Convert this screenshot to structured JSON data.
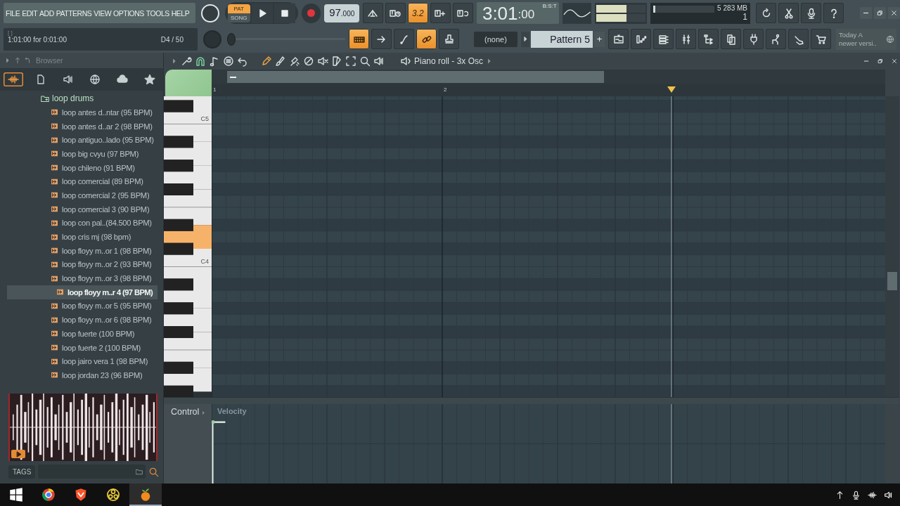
{
  "menu": [
    "FILE",
    "EDIT",
    "ADD",
    "PATTERNS",
    "VIEW",
    "OPTIONS",
    "TOOLS",
    "HELP"
  ],
  "hint": {
    "bracket": "[   ]",
    "text": "1:01:00 for 0:01:00",
    "position": "D4 / 50"
  },
  "transport": {
    "pat_label": "PAT",
    "song_label": "SONG",
    "pattern_mode": true
  },
  "tempo": {
    "whole": "97",
    "fraction": ".000"
  },
  "pitch": {
    "level": 0
  },
  "tools_top": [
    {
      "kind": "metronome",
      "on": false
    },
    {
      "kind": "keys-clock",
      "on": false
    },
    {
      "kind": "countdown",
      "label": "3.2",
      "on": true
    },
    {
      "kind": "keys-plus",
      "on": false
    },
    {
      "kind": "keys-loop",
      "on": false
    }
  ],
  "tools_bottom": [
    {
      "kind": "keyboard",
      "on": true
    },
    {
      "kind": "arrow",
      "on": false
    },
    {
      "kind": "curve",
      "on": false
    },
    {
      "kind": "link",
      "on": true
    },
    {
      "kind": "stamp",
      "on": false
    }
  ],
  "time": {
    "main": "3:01",
    "sub": ":00",
    "unit": "B:S:T"
  },
  "meter": {
    "left": {
      "level": 0.62
    },
    "right": {
      "level": 0.62
    }
  },
  "cpu": {
    "level": 0.04,
    "polyphony": "5",
    "memory": "283 MB",
    "voices": "1"
  },
  "actions": [
    {
      "kind": "refresh"
    },
    {
      "kind": "scissors"
    },
    {
      "kind": "microphone"
    },
    {
      "kind": "question"
    }
  ],
  "window_controls": [
    {
      "kind": "minimize"
    },
    {
      "kind": "restore"
    },
    {
      "kind": "close"
    }
  ],
  "pattern": {
    "channel": "(none)",
    "name": "Pattern 5",
    "add": "+"
  },
  "windows": [
    {
      "kind": "playlist",
      "on": false
    },
    {
      "kind": "bars-steps",
      "on": false
    },
    {
      "kind": "list",
      "on": false
    },
    {
      "kind": "sliders",
      "on": false
    },
    {
      "kind": "tree",
      "on": false
    },
    {
      "kind": "pages",
      "on": false
    },
    {
      "kind": "plug",
      "on": false
    },
    {
      "kind": "figure",
      "on": false
    },
    {
      "kind": "hand",
      "on": false
    },
    {
      "kind": "cart",
      "on": false
    }
  ],
  "news": {
    "line1": "Today  A",
    "line2": "newer versi.."
  },
  "browser": {
    "title": "Browser",
    "tabs": [
      {
        "kind": "waveform",
        "selected": true
      },
      {
        "kind": "file",
        "selected": false
      },
      {
        "kind": "speaker",
        "selected": false
      },
      {
        "kind": "globe",
        "selected": false
      },
      {
        "kind": "cloud",
        "selected": false
      },
      {
        "kind": "star",
        "selected": false
      }
    ],
    "folder": "loop drums",
    "items": [
      {
        "label": "loop antes d..ntar (95 BPM)",
        "selected": false
      },
      {
        "label": "loop antes d..ar 2 (98 BPM)",
        "selected": false
      },
      {
        "label": "loop antiguo..lado (95 BPM)",
        "selected": false
      },
      {
        "label": "loop big cvyu (97 BPM)",
        "selected": false
      },
      {
        "label": "loop chileno (91 BPM)",
        "selected": false
      },
      {
        "label": "loop comercial (89 BPM)",
        "selected": false
      },
      {
        "label": "loop comercial 2 (95 BPM)",
        "selected": false
      },
      {
        "label": "loop comercial 3 (90 BPM)",
        "selected": false
      },
      {
        "label": "loop con pal..(84.500 BPM)",
        "selected": false
      },
      {
        "label": "loop cris mj (98 bpm)",
        "selected": false
      },
      {
        "label": "loop floyy m..or 1 (98 BPM)",
        "selected": false
      },
      {
        "label": "loop floyy m..or 2 (93 BPM)",
        "selected": false
      },
      {
        "label": "loop floyy m..or 3 (98 BPM)",
        "selected": false
      },
      {
        "label": "loop floyy m..r 4 (97 BPM)",
        "selected": true
      },
      {
        "label": "loop floyy m..or 5 (95 BPM)",
        "selected": false
      },
      {
        "label": "loop floyy m..or 6 (98 BPM)",
        "selected": false
      },
      {
        "label": "loop fuerte (100 BPM)",
        "selected": false
      },
      {
        "label": "loop fuerte 2 (100 BPM)",
        "selected": false
      },
      {
        "label": "loop jairo vera 1 (98 BPM)",
        "selected": false
      },
      {
        "label": "loop jordan 23 (96 BPM)",
        "selected": false
      }
    ],
    "tags_label": "TAGS"
  },
  "piano_roll": {
    "title": "Piano roll - 3x Osc",
    "tools": [
      {
        "kind": "wrench",
        "on": false
      },
      {
        "kind": "magnet",
        "on": true
      },
      {
        "kind": "note",
        "on": false
      },
      {
        "kind": "menu",
        "on": false
      },
      {
        "kind": "undo",
        "on": false
      },
      {
        "kind": "pencil",
        "on": true
      },
      {
        "kind": "brush",
        "on": false
      },
      {
        "kind": "spray",
        "on": false
      },
      {
        "kind": "forbid",
        "on": false
      },
      {
        "kind": "mute",
        "on": false
      },
      {
        "kind": "slice",
        "on": false
      },
      {
        "kind": "frame",
        "on": false
      },
      {
        "kind": "zoom",
        "on": false
      },
      {
        "kind": "speaker",
        "on": false
      }
    ],
    "bars": [
      "1",
      "2"
    ],
    "octaves": [
      {
        "label": "C5",
        "white_keys": [
          {
            "hovered": false
          },
          {
            "hovered": false
          }
        ]
      },
      {
        "label": "C4",
        "white_keys": [
          {
            "hovered": false
          },
          {
            "hovered": true
          },
          {
            "hovered": false
          },
          {
            "hovered": false
          },
          {
            "hovered": false
          },
          {
            "hovered": false
          },
          {
            "hovered": false
          }
        ]
      }
    ],
    "control_label": "Control",
    "control_target": "Velocity"
  },
  "taskbar": [
    {
      "kind": "start",
      "active": false
    },
    {
      "kind": "globe-circle",
      "active": false
    },
    {
      "kind": "shield",
      "active": false
    },
    {
      "kind": "ring",
      "active": false
    },
    {
      "kind": "fruit",
      "active": true
    }
  ]
}
